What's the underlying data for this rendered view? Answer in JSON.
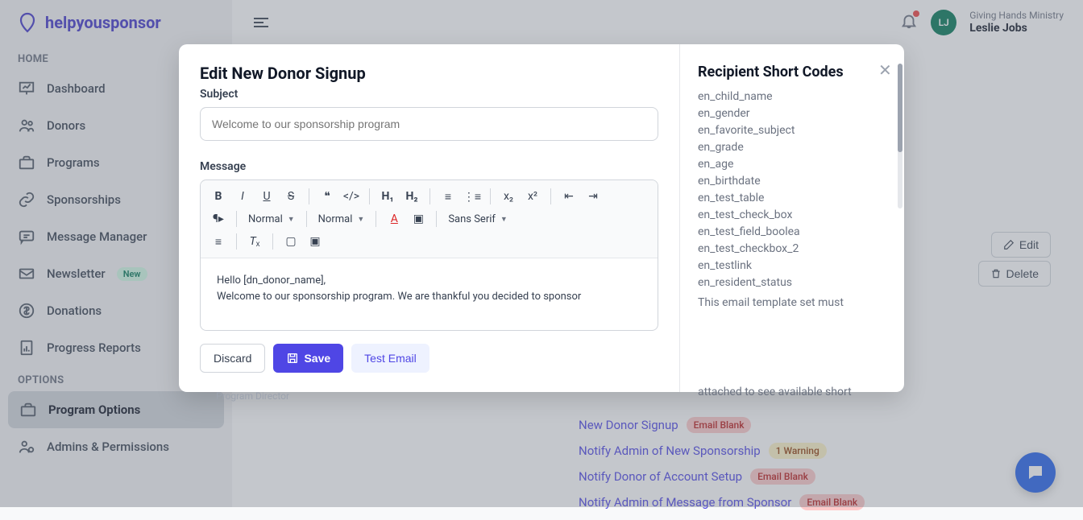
{
  "brand": {
    "name": "helpyousponsor"
  },
  "sidebar": {
    "section_home": "HOME",
    "section_options": "OPTIONS",
    "items": [
      {
        "label": "Dashboard"
      },
      {
        "label": "Donors"
      },
      {
        "label": "Programs"
      },
      {
        "label": "Sponsorships"
      },
      {
        "label": "Message Manager"
      },
      {
        "label": "Newsletter",
        "badge": "New"
      },
      {
        "label": "Donations"
      },
      {
        "label": "Progress Reports"
      }
    ],
    "options_items": [
      {
        "label": "Program Options"
      },
      {
        "label": "Admins & Permissions"
      }
    ]
  },
  "topbar": {
    "org": "Giving Hands Ministry",
    "user": "Leslie Jobs",
    "avatar_initials": "LJ"
  },
  "main": {
    "edit_label": "Edit",
    "delete_label": "Delete",
    "templates": [
      {
        "name": "New Donor Signup",
        "badge": "Email Blank",
        "badge_type": "red"
      },
      {
        "name": "Notify Admin of New Sponsorship",
        "badge": "1 Warning",
        "badge_type": "yellow"
      },
      {
        "name": "Notify Donor of Account Setup",
        "badge": "Email Blank",
        "badge_type": "red"
      },
      {
        "name": "Notify Admin of Message from Sponsor",
        "badge": "Email Blank",
        "badge_type": "red"
      }
    ]
  },
  "modal": {
    "title": "Edit New Donor Signup",
    "subject_label": "Subject",
    "subject_placeholder": "Welcome to our sponsorship program",
    "message_label": "Message",
    "toolbar": {
      "normal1": "Normal",
      "normal2": "Normal",
      "font": "Sans Serif"
    },
    "body_line1": "Hello [dn_donor_name],",
    "body_line2": "Welcome to our sponsorship program. We are thankful you decided to sponsor",
    "program_director": "Program Director",
    "actions": {
      "discard": "Discard",
      "save": "Save",
      "test_email": "Test Email"
    },
    "right": {
      "title": "Recipient Short Codes",
      "codes": [
        "en_child_name",
        "en_gender",
        "en_favorite_subject",
        "en_grade",
        "en_age",
        "en_birthdate",
        "en_test_table",
        "en_test_check_box",
        "en_test_field_boolea",
        "en_test_checkbox_2",
        "en_testlink",
        "en_resident_status"
      ],
      "note": "This email template set must",
      "bottom_text": "attached to see available short"
    }
  }
}
